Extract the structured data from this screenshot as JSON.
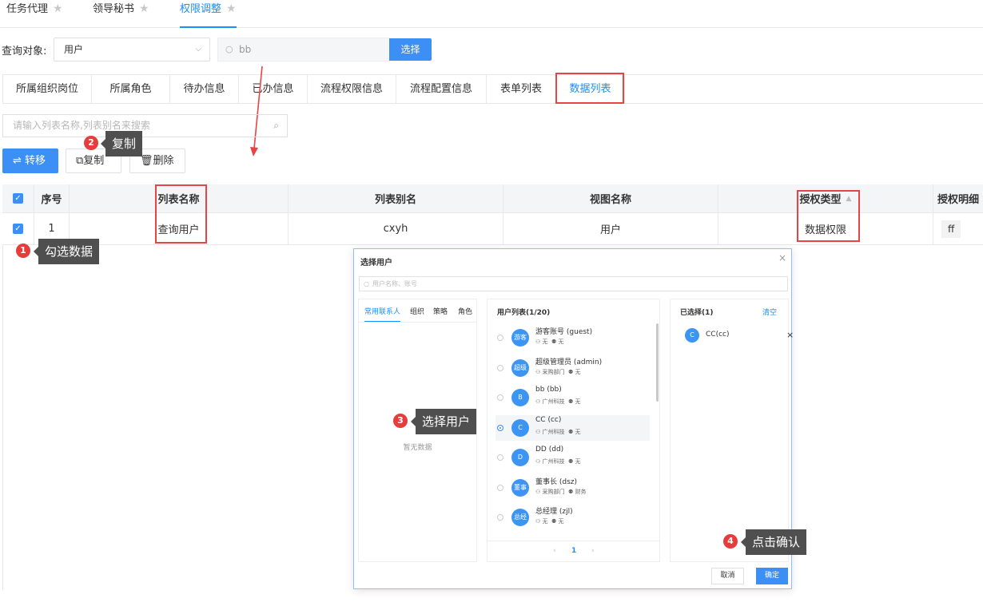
{
  "top_tabs": [
    {
      "label": "任务代理"
    },
    {
      "label": "领导秘书"
    },
    {
      "label": "权限调整"
    }
  ],
  "query": {
    "label": "查询对象:",
    "target": "用户",
    "search_value": "bb",
    "select_button": "选择"
  },
  "sub_tabs": [
    "所属组织岗位",
    "所属角色",
    "待办信息",
    "已办信息",
    "流程权限信息",
    "流程配置信息",
    "表单列表",
    "数据列表"
  ],
  "list_search": {
    "placeholder": "请输入列表名称,列表别名来搜索"
  },
  "actions": {
    "transfer": "转移",
    "copy": "复制",
    "delete": "删除"
  },
  "table": {
    "headers": [
      "序号",
      "列表名称",
      "列表别名",
      "视图名称",
      "授权类型",
      "授权明细"
    ],
    "rows": [
      {
        "index": "1",
        "name": "查询用户",
        "alias": "cxyh",
        "view": "用户",
        "auth_type": "数据权限",
        "detail": "ff"
      }
    ]
  },
  "annotations": [
    {
      "num": "1",
      "text": "勾选数据"
    },
    {
      "num": "2",
      "text": "复制"
    },
    {
      "num": "3",
      "text": "选择用户"
    },
    {
      "num": "4",
      "text": "点击确认"
    }
  ],
  "modal": {
    "title": "选择用户",
    "search_placeholder": "用户名称、账号",
    "left_tabs": [
      "常用联系人",
      "组织",
      "策略",
      "角色"
    ],
    "empty_text": "暂无数据",
    "user_list_title": "用户列表(1/20)",
    "users": [
      {
        "avatar": "游客",
        "name": "游客账号",
        "account": "(guest)",
        "org": "无",
        "role": "无"
      },
      {
        "avatar": "超级",
        "name": "超级管理员",
        "account": "(admin)",
        "org": "采购部门",
        "role": "无"
      },
      {
        "avatar": "B",
        "name": "bb",
        "account": "(bb)",
        "org": "广州科技",
        "role": "无"
      },
      {
        "avatar": "C",
        "name": "CC",
        "account": "(cc)",
        "org": "广州科技",
        "role": "无"
      },
      {
        "avatar": "D",
        "name": "DD",
        "account": "(dd)",
        "org": "广州科技",
        "role": "无"
      },
      {
        "avatar": "董事",
        "name": "董事长",
        "account": "(dsz)",
        "org": "采购部门",
        "role": "财务"
      },
      {
        "avatar": "总经",
        "name": "总经理",
        "account": "(zjl)",
        "org": "无",
        "role": "无"
      }
    ],
    "page": "1",
    "selected_title": "已选择(1)",
    "clear": "清空",
    "selected": [
      {
        "avatar": "C",
        "name": "CC(cc)"
      }
    ],
    "cancel": "取消",
    "ok": "确定"
  },
  "colors": {
    "primary": "#3c8ff5",
    "highlight": "#e64545",
    "tooltip": "#4f4f4f"
  }
}
